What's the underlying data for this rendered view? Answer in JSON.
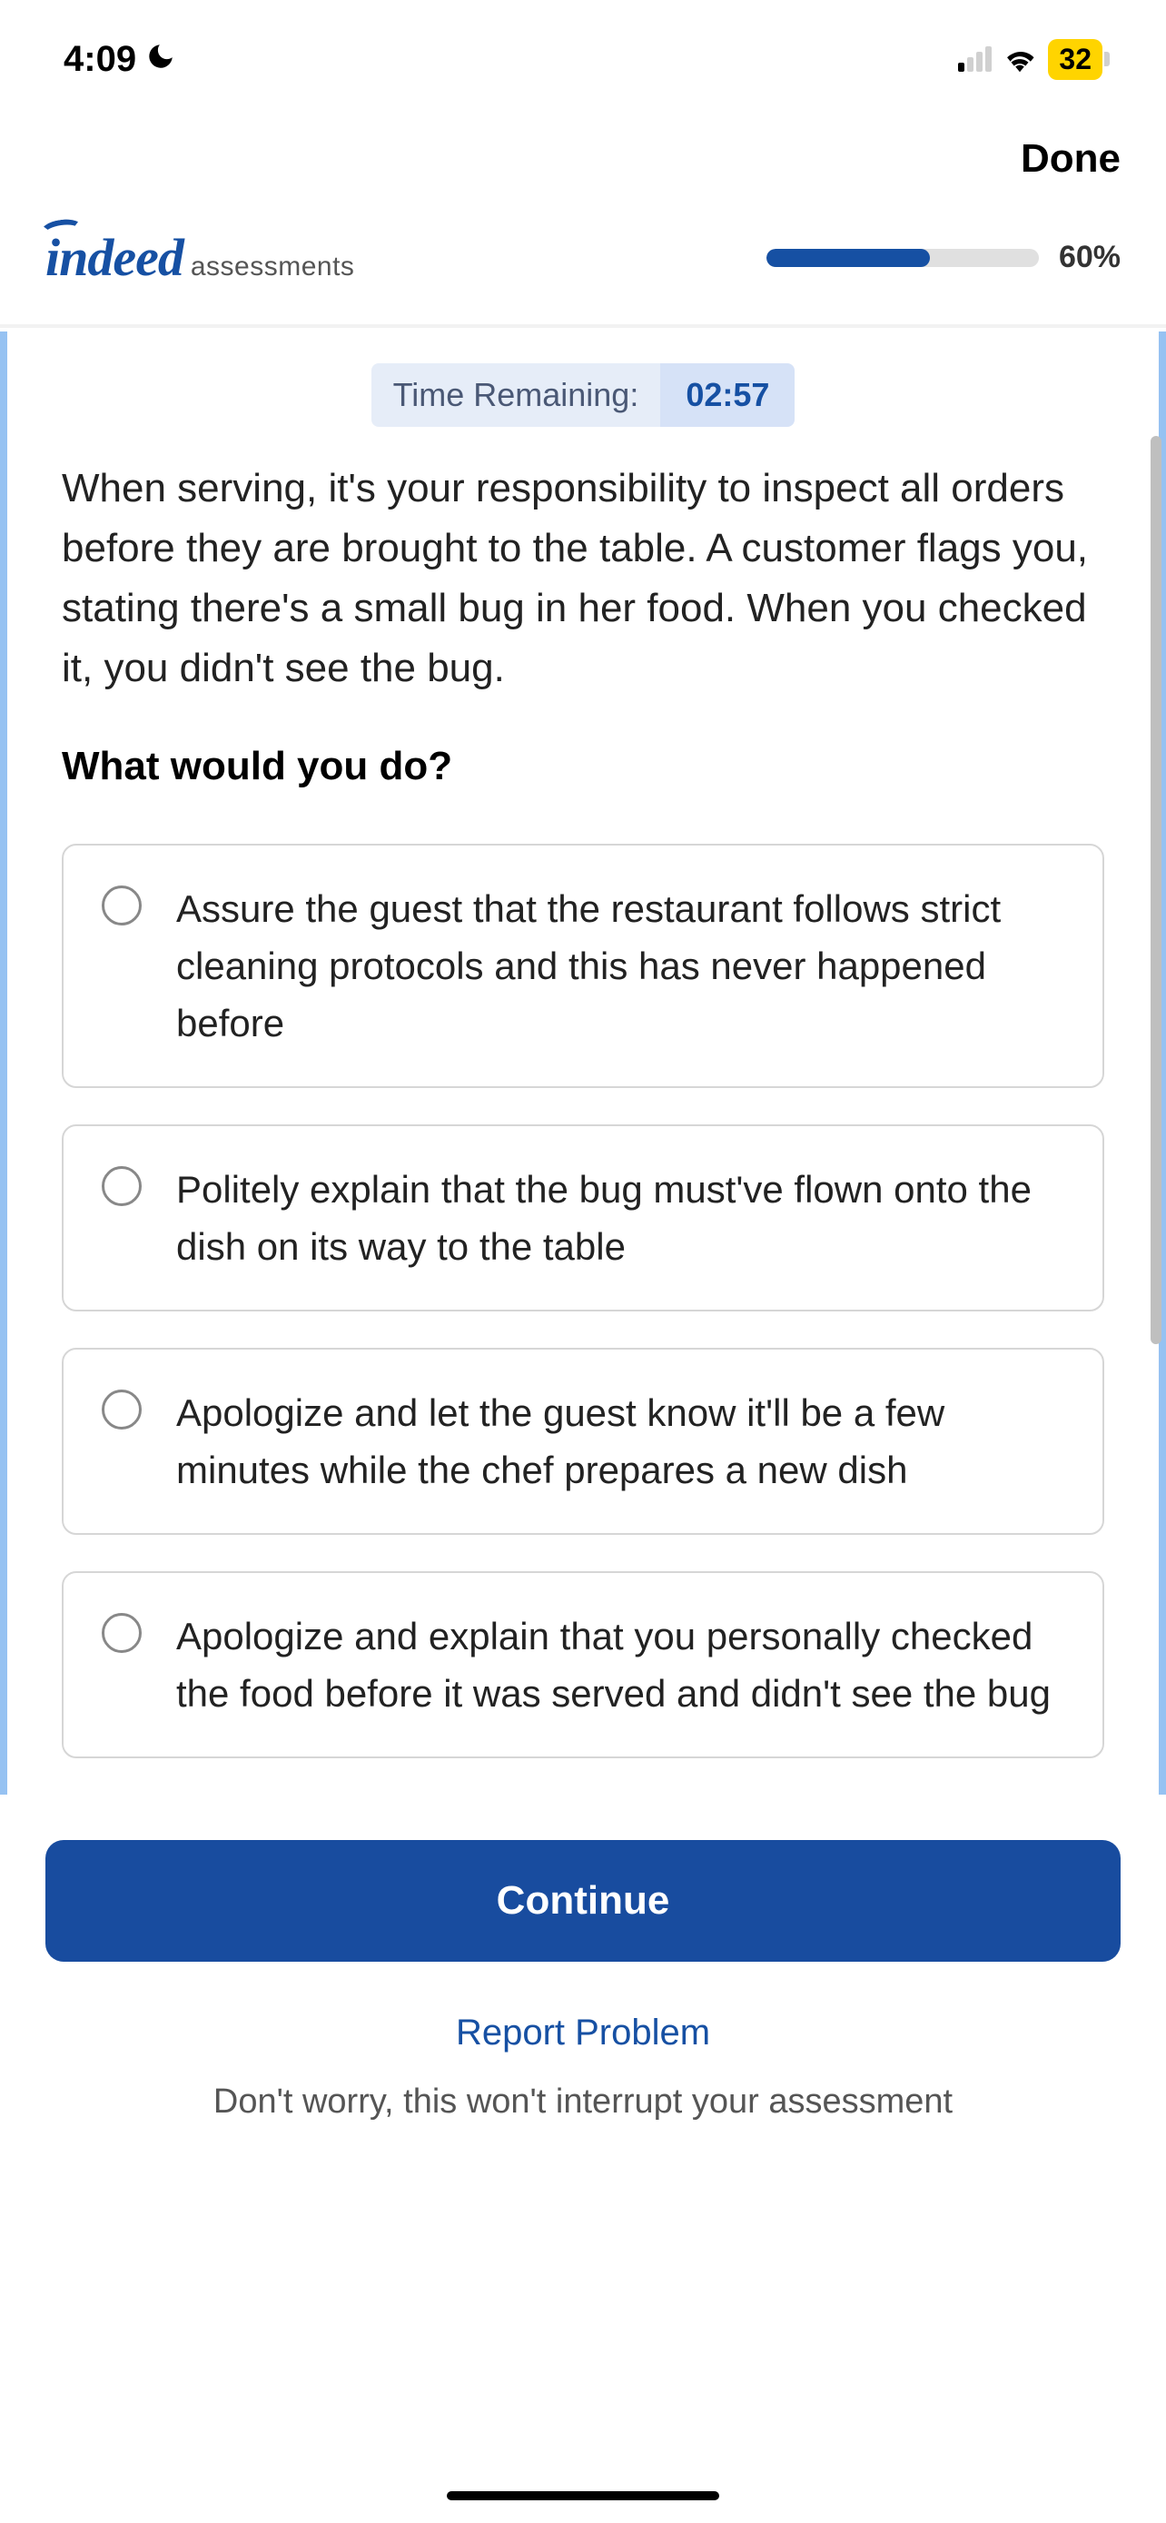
{
  "status": {
    "time": "4:09",
    "battery": "32"
  },
  "nav": {
    "done": "Done"
  },
  "brand": {
    "logo": "indeed",
    "sub": "assessments"
  },
  "progress": {
    "pct_label": "60%",
    "pct_value": 60
  },
  "timer": {
    "label": "Time Remaining:",
    "value": "02:57"
  },
  "question": {
    "scenario": "When serving, it's your responsibility to inspect all orders before they are brought to the table. A customer flags you, stating there's a small bug in her food. When you checked it, you didn't see the bug.",
    "prompt": "What would you do?"
  },
  "options": [
    "Assure the guest that the restaurant follows strict cleaning protocols and this has never happened before",
    "Politely explain that the bug must've flown onto the dish on its way to the table",
    "Apologize and let the guest know it'll be a few minutes while the chef prepares a new dish",
    "Apologize and explain that you personally checked the food before it was served and didn't see the bug"
  ],
  "actions": {
    "continue": "Continue",
    "report": "Report Problem",
    "note": "Don't worry, this won't interrupt your assessment"
  }
}
